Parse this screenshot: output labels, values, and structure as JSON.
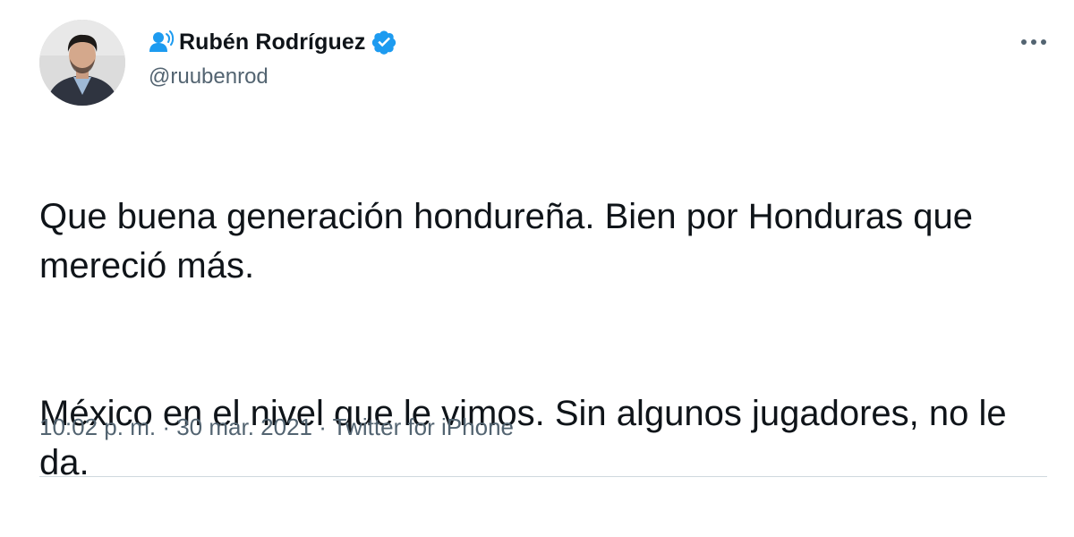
{
  "tweet": {
    "author": {
      "display_name": "Rubén Rodríguez",
      "handle": "@ruubenrod",
      "verified": true,
      "avatar_icon": "avatar-photo",
      "badge_icon": "spaces-speaker-icon"
    },
    "text": {
      "paragraph_1": "Que buena generación hondureña. Bien por Honduras que mereció más.",
      "paragraph_2": "México en el nivel que le vimos. Sin algunos jugadores, no le da."
    },
    "meta": {
      "time": "10:02 p. m.",
      "separator": "·",
      "date": "30 mar. 2021",
      "source": "Twitter for iPhone"
    },
    "more_icon": "more-horizontal-icon"
  },
  "colors": {
    "text_primary": "#0f1419",
    "text_secondary": "#536471",
    "verified_blue": "#1d9bf0",
    "divider": "#cfd9de"
  }
}
